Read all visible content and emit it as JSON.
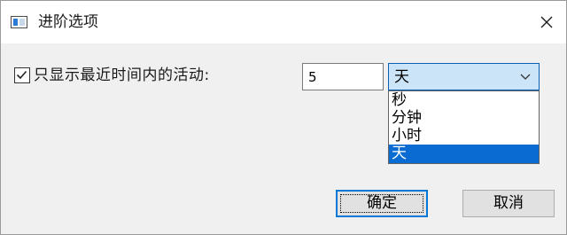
{
  "window": {
    "title": "进阶选项",
    "app_icon": "window-icon",
    "close_icon": "close-icon"
  },
  "filter": {
    "checkbox_checked": true,
    "label": "只显示最近时间内的活动:",
    "amount_value": "5",
    "unit_selected": "天",
    "unit_options": [
      "秒",
      "分钟",
      "小时",
      "天"
    ],
    "highlighted_index": 3
  },
  "buttons": {
    "ok_label": "确定",
    "cancel_label": "取消"
  },
  "colors": {
    "accent": "#0078d7",
    "select_bg": "#cce4f7",
    "option_highlight": "#0a6cd2"
  }
}
